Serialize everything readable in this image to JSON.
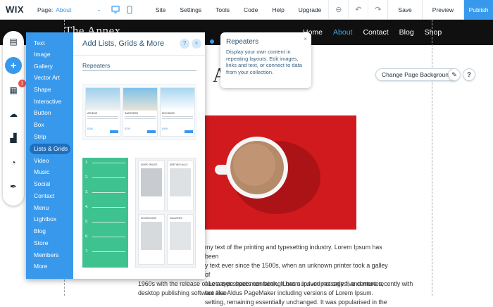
{
  "topbar": {
    "logo": "WIX",
    "page_label": "Page:",
    "page_value": "About",
    "menu": [
      "Site",
      "Settings",
      "Tools",
      "Code",
      "Help",
      "Upgrade"
    ],
    "save": "Save",
    "preview": "Preview",
    "publish": "Publish"
  },
  "site": {
    "title": "The Annex",
    "nav": [
      "Home",
      "About",
      "Contact",
      "Blog",
      "Shop"
    ],
    "active_nav": "About",
    "heading_visible": "A",
    "paragraph_lines": [
      "my text of the printing and typesetting industry. Lorem Ipsum has been",
      "y text ever since the 1500s, when an unknown printer took a galley of",
      "ake a type specimen book. It has survived not only five centuries, but also",
      "setting, remaining essentially unchanged. It was popularised in the",
      "1960s with the release of Letraset sheets containing Lorem Ipsum passages, and more recently with",
      "desktop publishing software like Aldus PageMaker including versions of Lorem Ipsum."
    ],
    "change_bg": "Change Page Background"
  },
  "tools": [
    "pages-icon",
    "add-icon",
    "apps-icon",
    "upload-icon",
    "store-icon",
    "chat-icon",
    "pen-icon"
  ],
  "tools_badge": "1",
  "add_panel": {
    "title": "Add Lists, Grids & More",
    "help": "?",
    "close": "×",
    "section": "Repeaters",
    "categories": [
      "Text",
      "Image",
      "Gallery",
      "Vector Art",
      "Shape",
      "Interactive",
      "Button",
      "Box",
      "Strip",
      "Lists & Grids",
      "Video",
      "Music",
      "Social",
      "Contact",
      "Menu",
      "Lightbox",
      "Blog",
      "Store",
      "Members",
      "More"
    ],
    "selected": "Lists & Grids",
    "thumb_cards": [
      {
        "name": "ATHENS",
        "price": "$156"
      },
      {
        "name": "SANTORINI",
        "price": "$799"
      },
      {
        "name": "MYKONOS",
        "price": "$499"
      }
    ],
    "green_list": [
      "1.",
      "2.",
      "3.",
      "4.",
      "5.",
      "6.",
      "7."
    ],
    "grid_cards": [
      "WORK SPACES",
      "MEETING HALLS",
      "SHOWROOMS",
      "GALLERIES"
    ]
  },
  "tooltip": {
    "title": "Repeaters",
    "desc": "Display your own content in repeating layouts. Edit images, links and text, or connect to data from your collection.",
    "close": "×"
  }
}
